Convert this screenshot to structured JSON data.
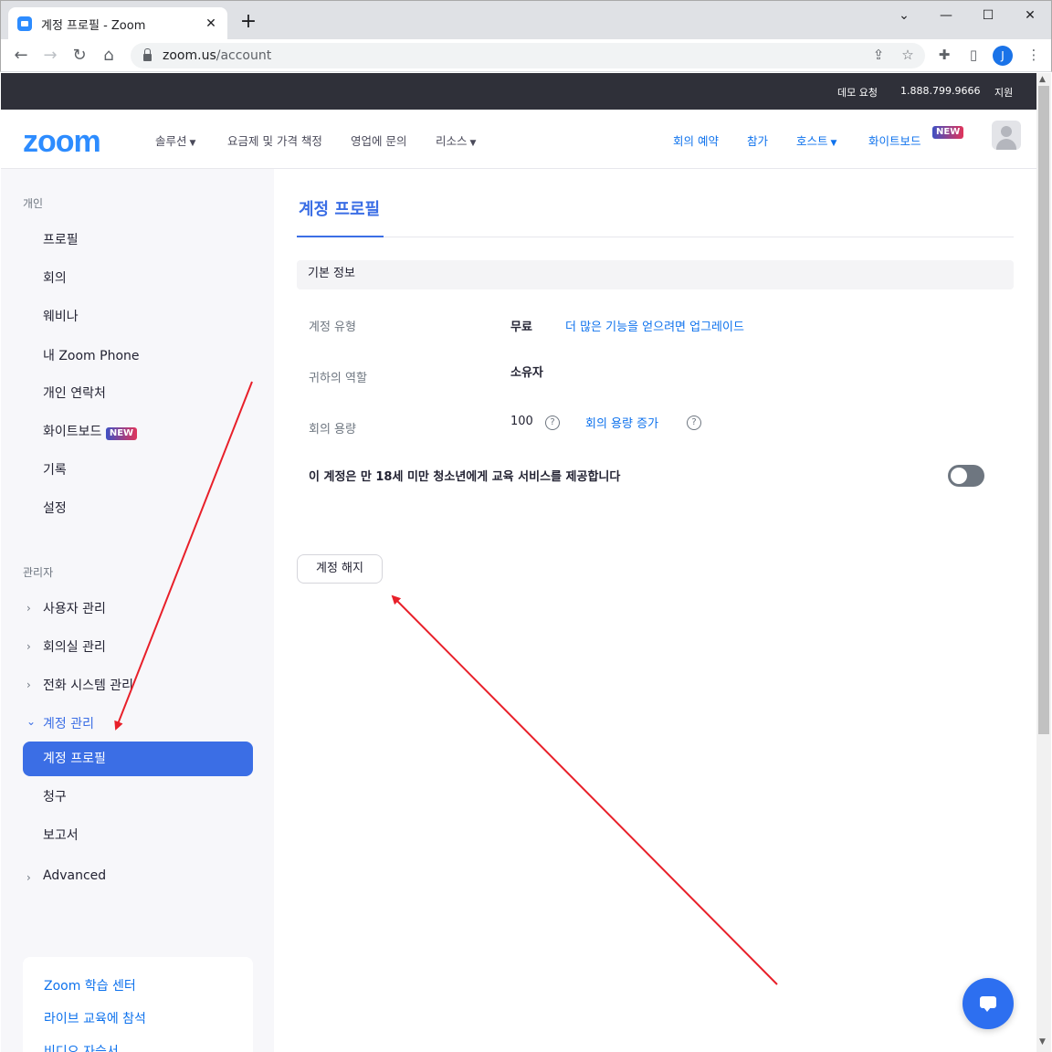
{
  "browser": {
    "tab_title": "계정 프로필 - Zoom",
    "tab_close": "✕",
    "new_tab": "+",
    "url_host": "zoom.us",
    "url_path": "/account",
    "profile_initial": "J",
    "window_controls": {
      "minimize": "⌄",
      "minimize2": "—",
      "maximize": "☐",
      "close": "✕"
    }
  },
  "top_strip": {
    "demo": "데모 요청",
    "phone": "1.888.799.9666",
    "support": "지원"
  },
  "nav": {
    "logo": "zoom",
    "solutions": "솔루션",
    "pricing": "요금제 및 가격 책정",
    "sales": "영업에 문의",
    "resources": "리소스",
    "schedule": "회의 예약",
    "join": "참가",
    "host": "호스트",
    "whiteboard": "화이트보드",
    "new_badge": "NEW"
  },
  "sidebar": {
    "personal_label": "개인",
    "personal_items": [
      "프로필",
      "회의",
      "웨비나",
      "내 Zoom Phone",
      "개인 연락처",
      "화이트보드",
      "기록",
      "설정"
    ],
    "whiteboard_badge": "NEW",
    "admin_label": "관리자",
    "admin_items": [
      "사용자 관리",
      "회의실 관리",
      "전화 시스템 관리",
      "계정 관리"
    ],
    "account_subitems": [
      "계정 프로필",
      "청구",
      "보고서"
    ],
    "advanced": "Advanced",
    "learn_links": [
      "Zoom 학습 센터",
      "라이브 교육에 참석",
      "비디오 자습서"
    ]
  },
  "content": {
    "title": "계정 프로필",
    "section": "기본 정보",
    "account_type_label": "계정 유형",
    "account_type_value": "무료",
    "upgrade_link": "더 많은 기능을 얻으려면 업그레이드",
    "role_label": "귀하의 역할",
    "role_value": "소유자",
    "capacity_label": "회의 용량",
    "capacity_value": "100",
    "capacity_link": "회의 용량 증가",
    "help_glyph": "?",
    "minors_text": "이 계정은 만 18세 미만 청소년에게 교육 서비스를 제공합니다",
    "minors_toggle_on": false,
    "terminate_button": "계정 해지"
  },
  "colors": {
    "accent": "#3b6ee5",
    "link": "#0e72ed",
    "annotation_arrow": "#e8202a"
  }
}
